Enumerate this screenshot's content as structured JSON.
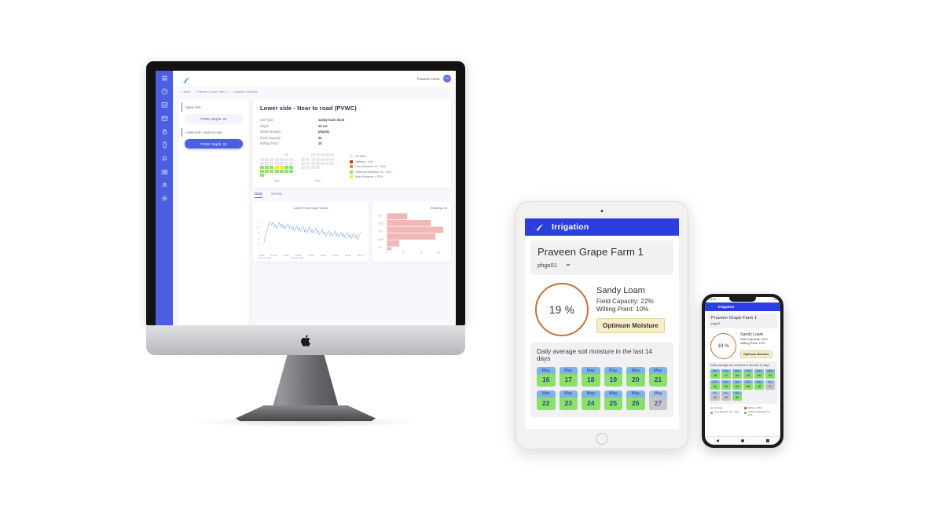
{
  "desktop": {
    "brand_icon": "leaf-check-logo",
    "user": {
      "name": "Praveen Horur",
      "initials": "PH"
    },
    "sidebar_icons": [
      "menu-icon",
      "dashboard-icon",
      "chart-icon",
      "mail-icon",
      "lock-icon",
      "device-icon",
      "bell-icon",
      "camera-icon",
      "user-icon",
      "settings-icon"
    ],
    "breadcrumb": [
      "Home",
      "Praveen Grape Farm 1",
      "Irrigation Advisory"
    ],
    "left_panel": {
      "groups": [
        {
          "label": "Upper side",
          "pill": "PVWC  Depth: 20",
          "active": false
        },
        {
          "label": "Lower side - Near to road",
          "pill": "PVWC  Depth: 20",
          "active": true
        }
      ]
    },
    "detail": {
      "title": "Lower side - Near to road  (PVWC)",
      "rows": [
        {
          "key": "Soil Type",
          "value": "sandy loam loam"
        },
        {
          "key": "Depth",
          "value": "20 cm"
        },
        {
          "key": "Serial Number",
          "value": "phgs01"
        },
        {
          "key": "Field Capacity",
          "value": "22"
        },
        {
          "key": "Wilting Point",
          "value": "10"
        }
      ]
    },
    "heatmap": {
      "months": [
        {
          "name": "May",
          "cells": [
            "n",
            "n",
            "n",
            "n",
            "n",
            "g0",
            "n",
            "g0",
            "g0",
            "g0",
            "g0",
            "g0",
            "g0",
            "g0",
            "g0",
            "g0",
            "g0",
            "g0",
            "g0",
            "g0",
            "g0",
            "g",
            "g",
            "g",
            "y",
            "y",
            "g",
            "g",
            "g",
            "g",
            "g",
            "g",
            "g",
            "g",
            "g",
            "g",
            "n",
            "n",
            "n",
            "n",
            "n",
            "n"
          ]
        },
        {
          "name": "June",
          "cells": [
            "n",
            "n",
            "g0",
            "g0",
            "g0",
            "g0",
            "g0",
            "g0",
            "g0",
            "g0",
            "g0",
            "g0",
            "g0",
            "g0",
            "g0",
            "g0",
            "g0",
            "g0",
            "g0",
            "g0",
            "g0",
            "g0",
            "g0",
            "g0",
            "g0",
            "n",
            "n",
            "n",
            "n",
            "n",
            "n",
            "n",
            "n",
            "n",
            "n",
            "n",
            "n",
            "n",
            "n",
            "n",
            "n",
            "n"
          ]
        }
      ],
      "legend": [
        {
          "label": "No data",
          "color": "#e7e8ee"
        },
        {
          "label": "Wilting  < 10%",
          "color": "#c0392b"
        },
        {
          "label": "Less Moisture  10 - 16%",
          "color": "#e08a2c"
        },
        {
          "label": "Optimum Moisture   16 - 22%",
          "color": "#8fe06b"
        },
        {
          "label": "More Moisture  >  22%",
          "color": "#f0e93c"
        }
      ]
    },
    "tabs": [
      {
        "label": "Daily",
        "active": true
      },
      {
        "label": "Weekly",
        "active": false
      }
    ],
    "charts": [
      {
        "title": "Latest Percentage Values",
        "x_ticks": [
          "18:00",
          "21:00",
          "00:00",
          "03:00",
          "06:00",
          "09:00",
          "12:00",
          "15:00",
          "18:00"
        ],
        "x_dates": [
          "May 29, 2022",
          "May 30, 2022"
        ]
      },
      {
        "title": "Readings Di"
      }
    ]
  },
  "tablet": {
    "app_title": "Irrigation",
    "logo_icon": "leaf-check-logo",
    "farm_name": "Praveen Grape Farm 1",
    "device_select": {
      "value": "phgs01",
      "caret": "chevron-down-icon"
    },
    "moisture_value": "19 %",
    "soil_type": "Sandy Loam",
    "field_capacity": "Field Capacity: 22%",
    "wilting_point": "Wilting Point: 10%",
    "status_badge": "Optimum Moisture",
    "calendar_title": "Daily average soil moisture in the last 14 days",
    "days": [
      {
        "month": "May",
        "day": "16",
        "state": "ok"
      },
      {
        "month": "May",
        "day": "17",
        "state": "ok"
      },
      {
        "month": "May",
        "day": "18",
        "state": "ok"
      },
      {
        "month": "May",
        "day": "19",
        "state": "ok"
      },
      {
        "month": "May",
        "day": "20",
        "state": "ok"
      },
      {
        "month": "May",
        "day": "21",
        "state": "ok"
      },
      {
        "month": "May",
        "day": "22",
        "state": "ok"
      },
      {
        "month": "May",
        "day": "23",
        "state": "ok"
      },
      {
        "month": "May",
        "day": "24",
        "state": "ok"
      },
      {
        "month": "May",
        "day": "25",
        "state": "ok"
      },
      {
        "month": "May",
        "day": "26",
        "state": "ok"
      },
      {
        "month": "May",
        "day": "27",
        "state": "nodata"
      }
    ]
  },
  "phone": {
    "status_left": "9:41 PM",
    "status_right": "LTE",
    "app_title": "Irrigation",
    "logo_icon": "leaf-check-logo",
    "farm_name": "Praveen Grape Farm 1",
    "device_select": {
      "value": "phgs01"
    },
    "moisture_value": "19 %",
    "soil_type": "Sandy Loam",
    "field_capacity": "Field Capacity: 22%",
    "wilting_point": "Wilting Point: 10%",
    "status_badge": "Optimum Moisture",
    "calendar_title": "Daily average soil moisture in the last 14 days",
    "days": [
      {
        "month": "May",
        "day": "16",
        "state": "ok"
      },
      {
        "month": "May",
        "day": "17",
        "state": "ok"
      },
      {
        "month": "May",
        "day": "18",
        "state": "ok"
      },
      {
        "month": "May",
        "day": "19",
        "state": "ok"
      },
      {
        "month": "May",
        "day": "20",
        "state": "ok"
      },
      {
        "month": "May",
        "day": "21",
        "state": "ok"
      },
      {
        "month": "May",
        "day": "22",
        "state": "ok"
      },
      {
        "month": "May",
        "day": "23",
        "state": "ok"
      },
      {
        "month": "May",
        "day": "24",
        "state": "ok"
      },
      {
        "month": "May",
        "day": "25",
        "state": "ok"
      },
      {
        "month": "May",
        "day": "26",
        "state": "ok"
      },
      {
        "month": "May",
        "day": "27",
        "state": "nodata"
      },
      {
        "month": "May",
        "day": "28",
        "state": "nodata"
      },
      {
        "month": "May",
        "day": "29",
        "state": "nodata"
      },
      {
        "month": "May",
        "day": "30",
        "state": "ok"
      }
    ],
    "legend": [
      {
        "label": "No data",
        "color": "#c5c5c7"
      },
      {
        "label": "Wilting < 10%",
        "color": "#c0392b"
      },
      {
        "label": "Less Moisture: 10 - 16%",
        "color": "#e08a2c"
      },
      {
        "label": "Optimum Moisture 16 - 22%",
        "color": "#57b35a"
      }
    ],
    "nav_icons": [
      "back-icon",
      "home-icon",
      "recents-icon"
    ]
  },
  "colors": {
    "brand_blue": "#2b3fe0",
    "sidebar_blue": "#4c5fe0",
    "ring_orange": "#c2703d",
    "optimum_green": "#8ce06a",
    "day_header_blue": "#7fb3ea",
    "badge_cream": "#f7eec9"
  }
}
